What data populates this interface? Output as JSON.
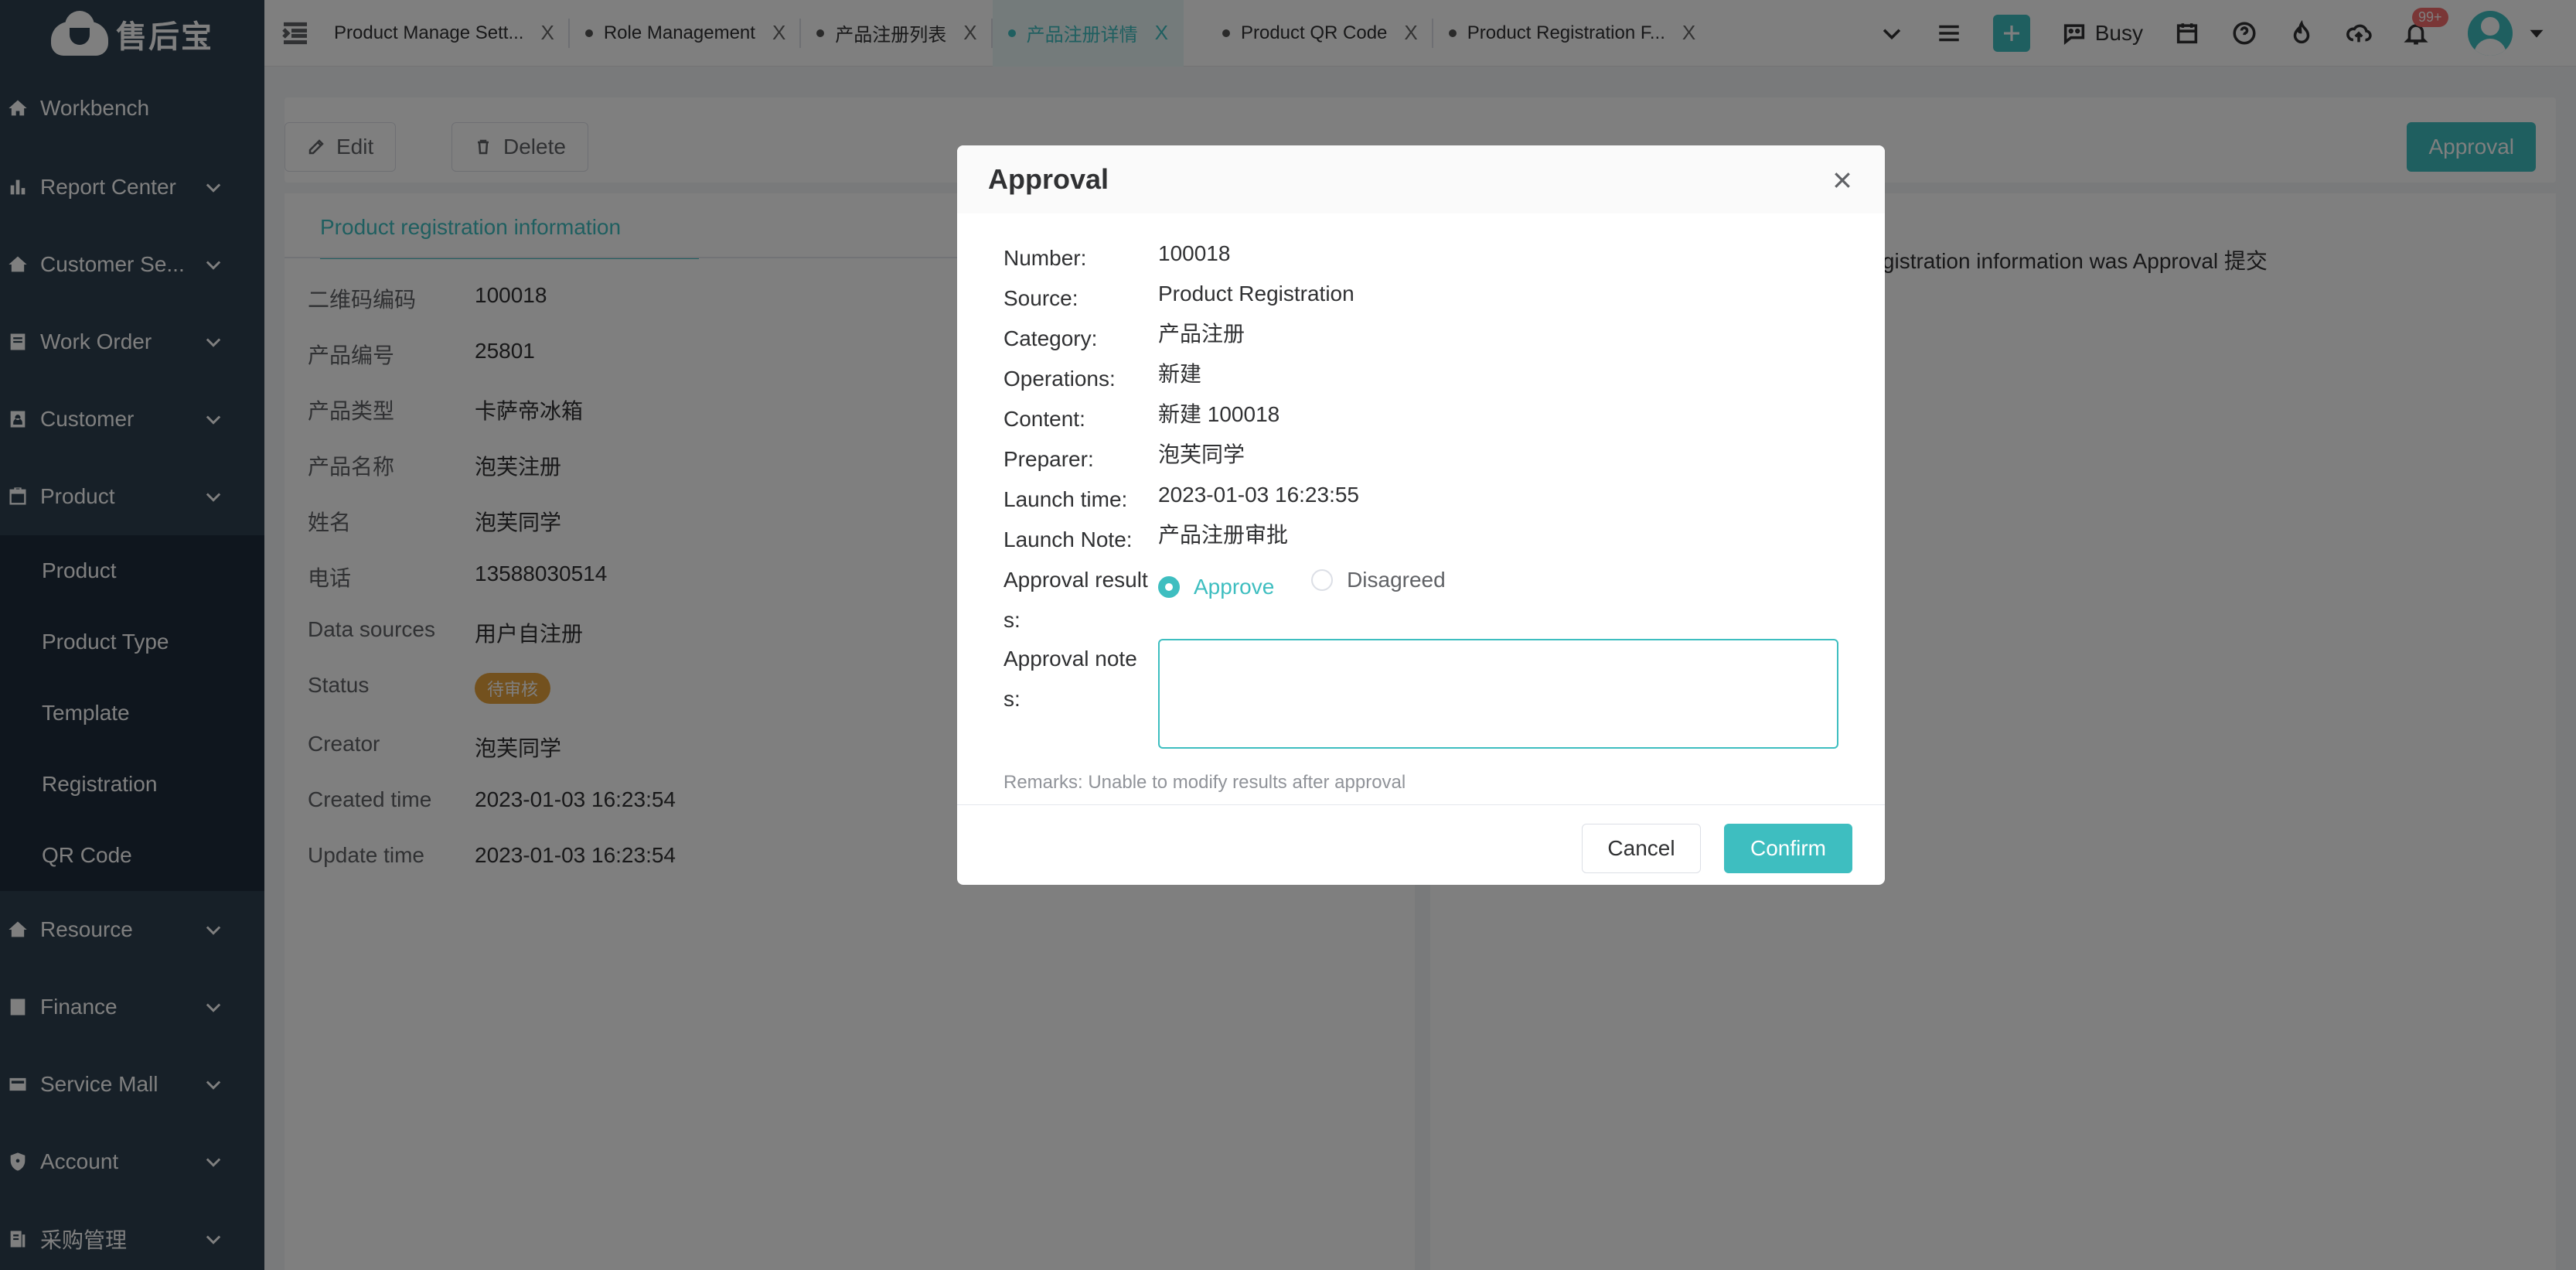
{
  "app": {
    "logo_text": "售后宝"
  },
  "sidebar": {
    "items": [
      {
        "label": "Workbench",
        "icon": "home-icon"
      },
      {
        "label": "Report Center",
        "icon": "report-icon"
      },
      {
        "label": "Customer Se...",
        "icon": "home-icon"
      },
      {
        "label": "Work Order",
        "icon": "order-icon"
      },
      {
        "label": "Customer",
        "icon": "customer-icon"
      },
      {
        "label": "Product",
        "icon": "product-icon"
      },
      {
        "label": "Resource",
        "icon": "home-icon"
      },
      {
        "label": "Finance",
        "icon": "finance-icon"
      },
      {
        "label": "Service Mall",
        "icon": "mall-icon"
      },
      {
        "label": "Account",
        "icon": "shield-icon"
      },
      {
        "label": "采购管理",
        "icon": "purchase-icon"
      }
    ],
    "product_submenu": [
      "Product",
      "Product Type",
      "Template",
      "Registration",
      "QR Code"
    ]
  },
  "tabs": [
    {
      "label": "Product Manage Sett...",
      "dot": false,
      "active": false
    },
    {
      "label": "Role Management",
      "dot": true,
      "active": false
    },
    {
      "label": "产品注册列表",
      "dot": true,
      "active": false
    },
    {
      "label": "产品注册详情",
      "dot": true,
      "active": true
    },
    {
      "label": "Product QR Code",
      "dot": true,
      "active": false
    },
    {
      "label": "Product Registration F...",
      "dot": true,
      "active": false
    }
  ],
  "toolbar": {
    "busy_label": "Busy",
    "notification_count": "99+"
  },
  "actions": {
    "edit_label": "Edit",
    "delete_label": "Delete",
    "approval_label": "Approval"
  },
  "detail": {
    "tab_label": "Product registration information",
    "fields": [
      {
        "key": "二维码编码",
        "value": "100018"
      },
      {
        "key": "产品编号",
        "value": "25801"
      },
      {
        "key": "产品类型",
        "value": "卡萨帝冰箱"
      },
      {
        "key": "产品名称",
        "value": "泡芙注册"
      },
      {
        "key": "姓名",
        "value": "泡芙同学"
      },
      {
        "key": "电话",
        "value": "13588030514"
      },
      {
        "key": "Data sources",
        "value": "用户自注册"
      },
      {
        "key": "Status",
        "value": "待审核"
      },
      {
        "key": "Creator",
        "value": "泡芙同学"
      },
      {
        "key": "Created time",
        "value": "2023-01-03 16:23:54"
      },
      {
        "key": "Update time",
        "value": "2023-01-03 16:23:54"
      }
    ],
    "log_text": "registration information was Approval 提交"
  },
  "modal": {
    "title": "Approval",
    "rows": [
      {
        "key": "Number:",
        "value": "100018"
      },
      {
        "key": "Source:",
        "value": "Product Registration"
      },
      {
        "key": "Category:",
        "value": "产品注册"
      },
      {
        "key": "Operations:",
        "value": "新建"
      },
      {
        "key": "Content:",
        "value": "新建 100018"
      },
      {
        "key": "Preparer:",
        "value": "泡芙同学"
      },
      {
        "key": "Launch time:",
        "value": "2023-01-03 16:23:55"
      },
      {
        "key": "Launch Note:",
        "value": "产品注册审批"
      }
    ],
    "result_label_1": "Approval result",
    "result_label_2": "s:",
    "approve_label": "Approve",
    "disagree_label": "Disagreed",
    "notes_label_1": "Approval note",
    "notes_label_2": "s:",
    "notes_value": "",
    "remarks": "Remarks:  Unable to modify results after approval",
    "cancel_label": "Cancel",
    "confirm_label": "Confirm"
  },
  "colors": {
    "accent": "#3ebec0",
    "sidebar": "#2f4050",
    "status_pending": "#e6a23c"
  }
}
